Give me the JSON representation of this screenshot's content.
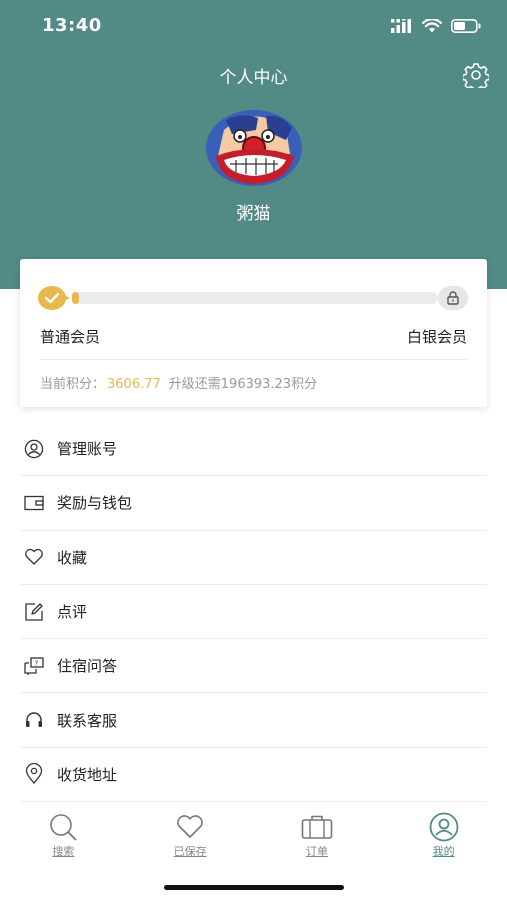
{
  "status": {
    "time": "13:40"
  },
  "header": {
    "title": "个人中心",
    "username": "粥猫"
  },
  "member": {
    "progress": 0.02,
    "current_level": "普通会员",
    "next_level": "白银会员",
    "points_label": "当前积分：",
    "points_value": "3606.77",
    "upgrade_text": "升级还需196393.23积分"
  },
  "menu": [
    {
      "label": "管理账号",
      "icon": "user-icon"
    },
    {
      "label": "奖励与钱包",
      "icon": "wallet-icon"
    },
    {
      "label": "收藏",
      "icon": "heart-icon"
    },
    {
      "label": "点评",
      "icon": "edit-icon"
    },
    {
      "label": "住宿问答",
      "icon": "qa-icon"
    },
    {
      "label": "联系客服",
      "icon": "headset-icon"
    },
    {
      "label": "收货地址",
      "icon": "location-icon"
    }
  ],
  "tabs": [
    {
      "label": "搜索",
      "icon": "search-icon"
    },
    {
      "label": "已保存",
      "icon": "heart-icon"
    },
    {
      "label": "订单",
      "icon": "briefcase-icon"
    },
    {
      "label": "我的",
      "icon": "profile-icon",
      "active": true
    }
  ],
  "colors": {
    "header_bg": "#528a85",
    "accent_gold": "#e9b84c",
    "active_tab": "#528a85"
  }
}
